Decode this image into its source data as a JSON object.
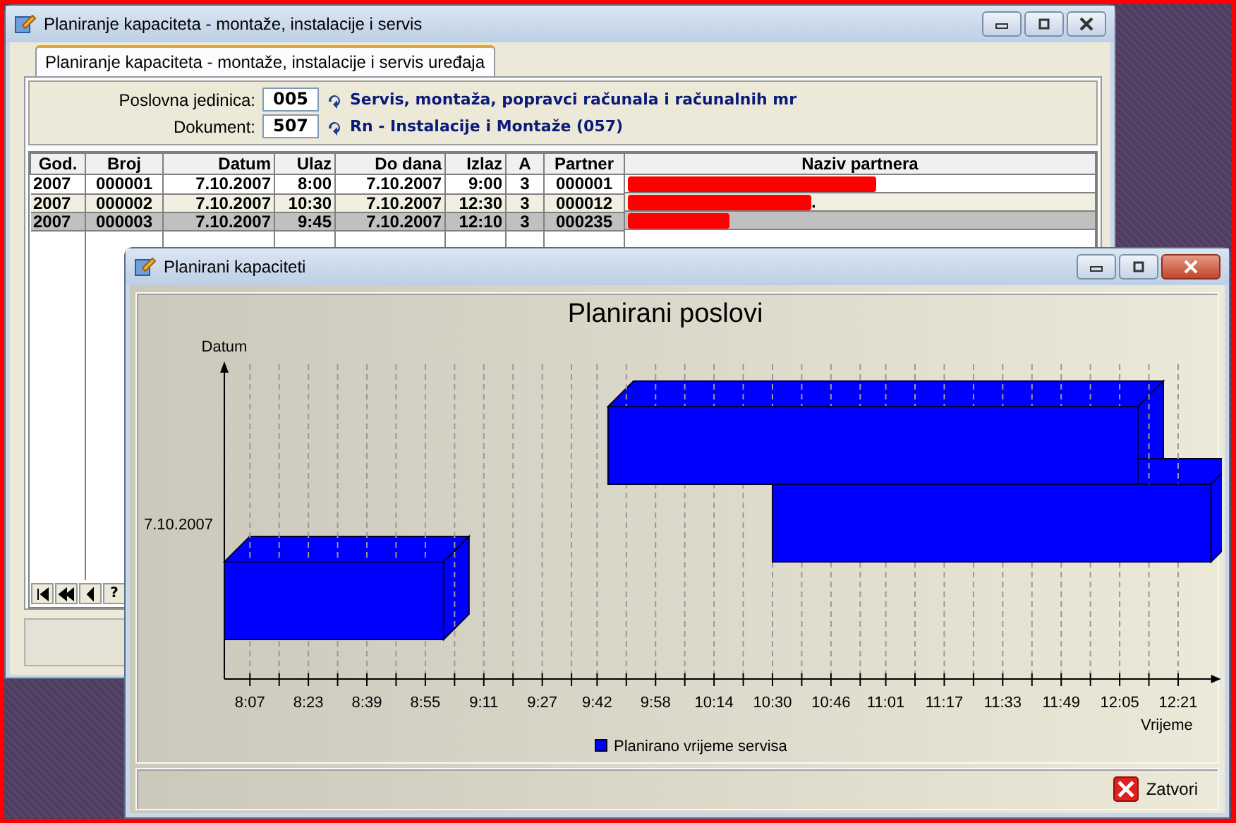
{
  "back_window": {
    "title": "Planiranje kapaciteta - montaže, instalacije i servis",
    "tabs": [
      {
        "label": "Planiranje kapaciteta - montaže, instalacije i servis uređaja",
        "selected": true
      }
    ],
    "fields": [
      {
        "label": "Poslovna jedinica:",
        "value": "005",
        "link": "Servis, montaža, popravci računala i računalnih mr"
      },
      {
        "label": "Dokument:",
        "value": "507",
        "link": "Rn - Instalacije i Montaže (057)"
      }
    ],
    "table": {
      "columns": [
        "God.",
        "Broj",
        "Datum",
        "Ulaz",
        "Do dana",
        "Izlaz",
        "A",
        "Partner",
        "Naziv partnera"
      ],
      "rows": [
        {
          "cells": [
            "2007",
            "000001",
            "7.10.2007",
            "8:00",
            "7.10.2007",
            "9:00",
            "3",
            "000001"
          ],
          "redacted": true,
          "selected": false
        },
        {
          "cells": [
            "2007",
            "000002",
            "7.10.2007",
            "10:30",
            "7.10.2007",
            "12:30",
            "3",
            "000012"
          ],
          "naziv": ".",
          "redacted": true,
          "selected": false
        },
        {
          "cells": [
            "2007",
            "000003",
            "7.10.2007",
            "9:45",
            "7.10.2007",
            "12:10",
            "3",
            "000235"
          ],
          "redacted": true,
          "selected": true
        }
      ]
    },
    "navigator": {
      "help": "?"
    }
  },
  "front_window": {
    "title": "Planirani kapaciteti",
    "chart_data": {
      "type": "bar",
      "orientation": "horizontal",
      "title": "Planirani poslovi",
      "xlabel": "Vrijeme",
      "ylabel": "Datum",
      "xlim": [
        480,
        750
      ],
      "xticks": [
        {
          "value": 487,
          "label": "8:07"
        },
        {
          "value": 503,
          "label": "8:23"
        },
        {
          "value": 519,
          "label": "8:39"
        },
        {
          "value": 535,
          "label": "8:55"
        },
        {
          "value": 551,
          "label": "9:11"
        },
        {
          "value": 567,
          "label": "9:27"
        },
        {
          "value": 582,
          "label": "9:42"
        },
        {
          "value": 598,
          "label": "9:58"
        },
        {
          "value": 614,
          "label": "10:14"
        },
        {
          "value": 630,
          "label": "10:30"
        },
        {
          "value": 646,
          "label": "10:46"
        },
        {
          "value": 661,
          "label": "11:01"
        },
        {
          "value": 677,
          "label": "11:17"
        },
        {
          "value": 693,
          "label": "11:33"
        },
        {
          "value": 709,
          "label": "11:49"
        },
        {
          "value": 725,
          "label": "12:05"
        },
        {
          "value": 741,
          "label": "12:21"
        }
      ],
      "series": [
        {
          "name": "Planirano vrijeme servisa",
          "color": "#0000ff",
          "values": [
            145,
            120,
            60
          ],
          "base": [
            585,
            630,
            480
          ]
        }
      ],
      "grid": true
    },
    "date_label": "7.10.2007",
    "close_button": "Zatvori"
  }
}
